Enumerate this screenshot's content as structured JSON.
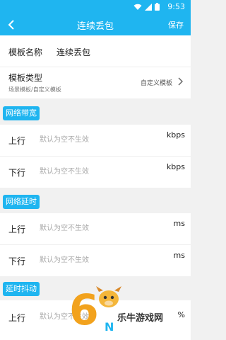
{
  "status_bar": {
    "time": "9:53"
  },
  "app_bar": {
    "title": "连续丢包",
    "save_label": "保存"
  },
  "template_name": {
    "label": "模板名称",
    "value": "连续丢包"
  },
  "template_type": {
    "label": "模板类型",
    "hint": "场景模板/自定义模板",
    "selected": "自定义模板"
  },
  "sections": [
    {
      "title": "网络带宽",
      "fields": [
        {
          "label": "上行",
          "placeholder": "默认为空不生效",
          "unit": "kbps"
        },
        {
          "label": "下行",
          "placeholder": "默认为空不生效",
          "unit": "kbps"
        }
      ]
    },
    {
      "title": "网络延时",
      "fields": [
        {
          "label": "上行",
          "placeholder": "默认为空不生效",
          "unit": "ms"
        },
        {
          "label": "下行",
          "placeholder": "默认为空不生效",
          "unit": "ms"
        }
      ]
    },
    {
      "title": "延时抖动",
      "fields": [
        {
          "label": "上行",
          "placeholder": "默认为空不生效",
          "unit": "%"
        }
      ]
    }
  ],
  "watermark": {
    "brand": "乐牛游戏网"
  },
  "colors": {
    "accent": "#1fb5f0",
    "background": "#f1f1f1"
  }
}
